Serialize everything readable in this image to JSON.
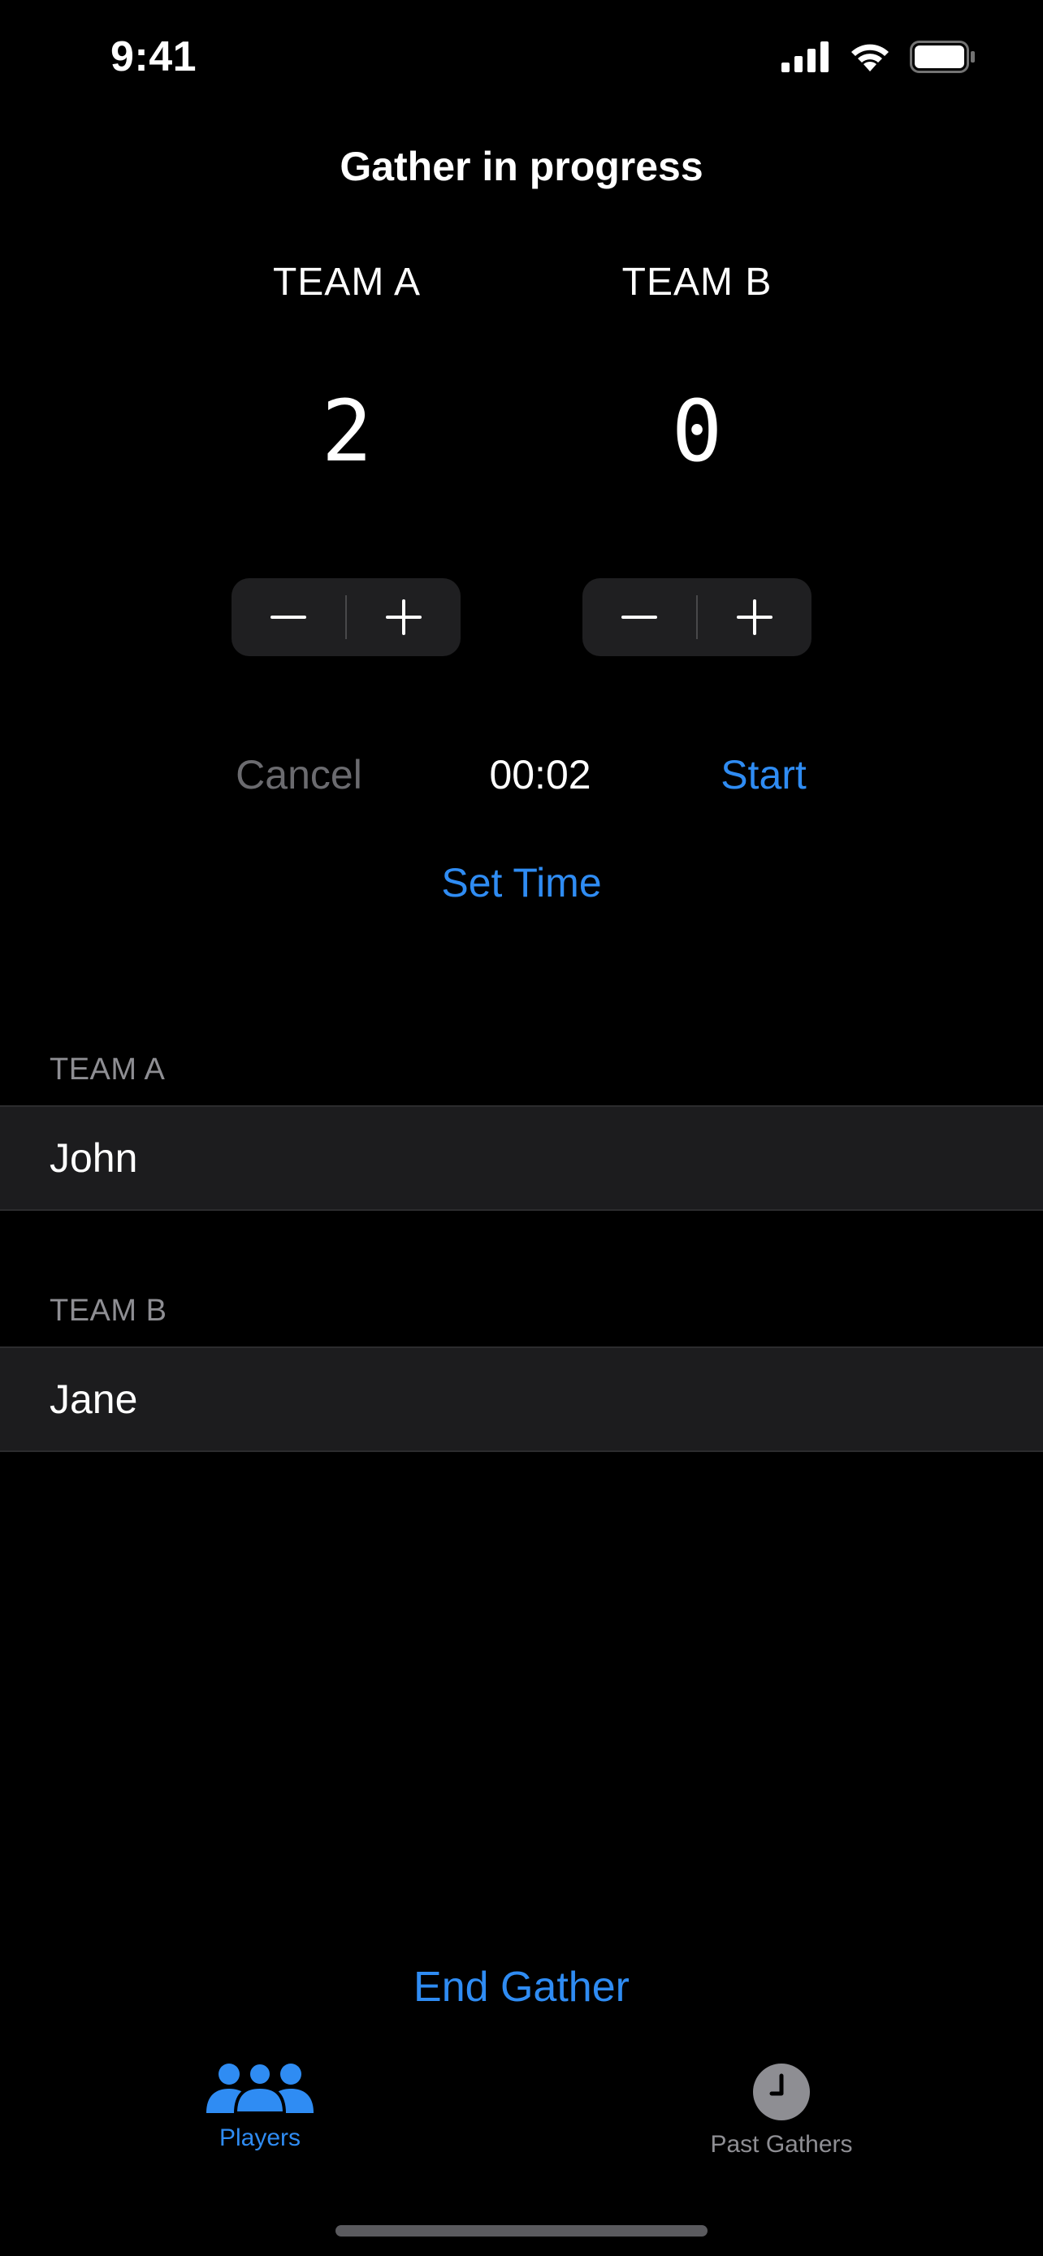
{
  "status_bar": {
    "time": "9:41",
    "icons": [
      "cellular-signal-icon",
      "wifi-icon",
      "battery-icon"
    ]
  },
  "header": {
    "title": "Gather in progress"
  },
  "scoreboard": {
    "team_a": {
      "label": "TEAM A",
      "score": "2"
    },
    "team_b": {
      "label": "TEAM B",
      "score": "0"
    }
  },
  "timer": {
    "cancel_label": "Cancel",
    "display": "00:02",
    "start_label": "Start",
    "set_time_label": "Set Time"
  },
  "teams": [
    {
      "header": "TEAM A",
      "players": [
        "John"
      ]
    },
    {
      "header": "TEAM B",
      "players": [
        "Jane"
      ]
    }
  ],
  "actions": {
    "end_gather_label": "End Gather"
  },
  "tab_bar": {
    "tabs": [
      {
        "label": "Players",
        "icon": "people-icon",
        "selected": true
      },
      {
        "label": "Past Gathers",
        "icon": "clock-icon",
        "selected": false
      }
    ]
  },
  "colors": {
    "accent": "#2f8cf3",
    "background": "#000000",
    "row_background": "#1c1c1e",
    "disabled_text": "#6b6b6f",
    "secondary_text": "#8e8e93"
  }
}
